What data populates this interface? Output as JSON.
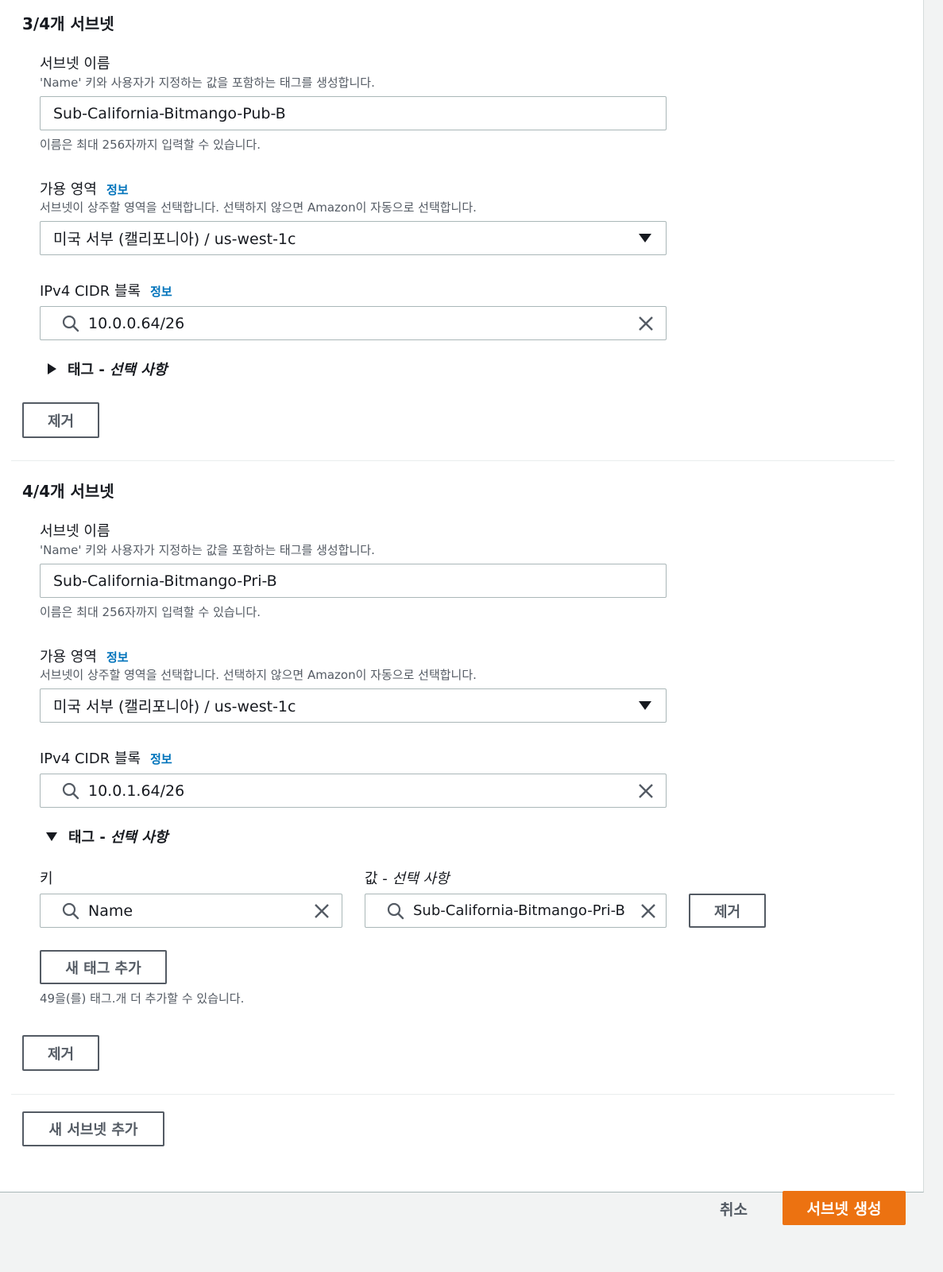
{
  "subnet3": {
    "title": "3/4개 서브넷",
    "name_label": "서브넷 이름",
    "name_desc": "'Name' 키와 사용자가 지정하는 값을 포함하는 태그를 생성합니다.",
    "name_value": "Sub-California-Bitmango-Pub-B",
    "name_hint": "이름은 최대 256자까지 입력할 수 있습니다.",
    "az_label": "가용 영역",
    "az_info": "정보",
    "az_desc": "서브넷이 상주할 영역을 선택합니다. 선택하지 않으면 Amazon이 자동으로 선택합니다.",
    "az_value": "미국 서부 (캘리포니아) / us-west-1c",
    "cidr_label": "IPv4 CIDR 블록",
    "cidr_info": "정보",
    "cidr_value": "10.0.0.64/26",
    "tags_label": "태그 -",
    "tags_optional": "선택 사항",
    "remove_label": "제거"
  },
  "subnet4": {
    "title": "4/4개 서브넷",
    "name_label": "서브넷 이름",
    "name_desc": "'Name' 키와 사용자가 지정하는 값을 포함하는 태그를 생성합니다.",
    "name_value": "Sub-California-Bitmango-Pri-B",
    "name_hint": "이름은 최대 256자까지 입력할 수 있습니다.",
    "az_label": "가용 영역",
    "az_info": "정보",
    "az_desc": "서브넷이 상주할 영역을 선택합니다. 선택하지 않으면 Amazon이 자동으로 선택합니다.",
    "az_value": "미국 서부 (캘리포니아) / us-west-1c",
    "cidr_label": "IPv4 CIDR 블록",
    "cidr_info": "정보",
    "cidr_value": "10.0.1.64/26",
    "tags_label": "태그 -",
    "tags_optional": "선택 사항",
    "tag_key_label": "키",
    "tag_value_label": "값 -",
    "tag_value_optional": "선택 사항",
    "tag_key": "Name",
    "tag_value": "Sub-California-Bitmango-Pri-B",
    "tag_remove_label": "제거",
    "add_tag_label": "새 태그 추가",
    "tag_hint": "49을(를) 태그.개 더 추가할 수 있습니다.",
    "remove_label": "제거"
  },
  "add_subnet_label": "새 서브넷 추가",
  "footer": {
    "cancel_label": "취소",
    "create_label": "서브넷 생성"
  },
  "colors": {
    "primary": "#ec7211",
    "link": "#0073bb",
    "border": "#aab7b8"
  }
}
